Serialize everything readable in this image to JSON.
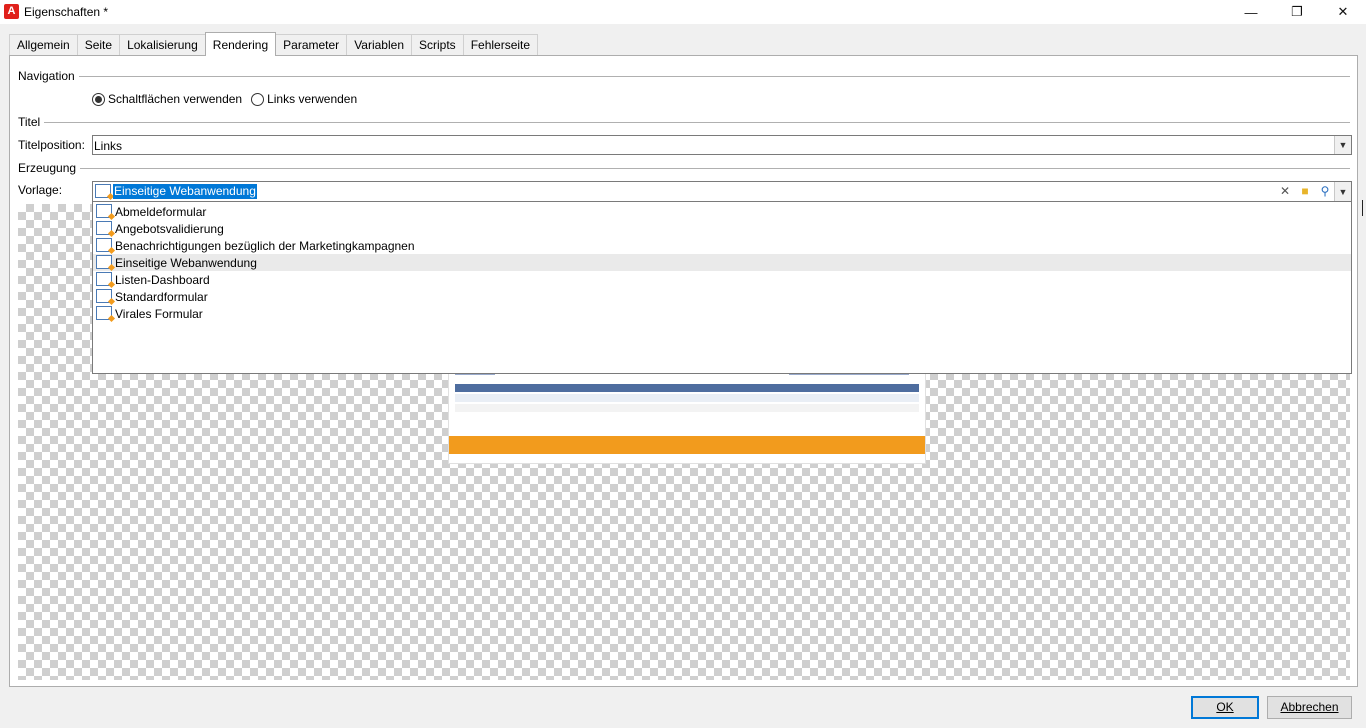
{
  "window": {
    "title": "Eigenschaften *",
    "app_icon_letter": "A",
    "controls": {
      "minimize": "—",
      "maximize": "❐",
      "close": "✕"
    }
  },
  "tabs": [
    {
      "label": "Allgemein",
      "active": false
    },
    {
      "label": "Seite",
      "active": false
    },
    {
      "label": "Lokalisierung",
      "active": false
    },
    {
      "label": "Rendering",
      "active": true
    },
    {
      "label": "Parameter",
      "active": false
    },
    {
      "label": "Variablen",
      "active": false
    },
    {
      "label": "Scripts",
      "active": false
    },
    {
      "label": "Fehlerseite",
      "active": false
    }
  ],
  "navigation": {
    "section_label": "Navigation",
    "options": [
      {
        "label": "Schaltflächen verwenden",
        "selected": true
      },
      {
        "label": "Links verwenden",
        "selected": false
      }
    ]
  },
  "titel": {
    "section_label": "Titel",
    "position_label": "Titelposition:",
    "position_value": "Links"
  },
  "erzeugung": {
    "section_label": "Erzeugung",
    "template_label": "Vorlage:",
    "template_value": "Einseitige Webanwendung",
    "dropdown_items": [
      {
        "label": "Abmeldeformular",
        "highlighted": false
      },
      {
        "label": "Angebotsvalidierung",
        "highlighted": false
      },
      {
        "label": "Benachrichtigungen bezüglich der Marketingkampagnen",
        "highlighted": false
      },
      {
        "label": "Einseitige Webanwendung",
        "highlighted": true
      },
      {
        "label": "Listen-Dashboard",
        "highlighted": false
      },
      {
        "label": "Standardformular",
        "highlighted": false
      },
      {
        "label": "Virales Formular",
        "highlighted": false
      }
    ]
  },
  "footer": {
    "ok_label": "OK",
    "cancel_label": "Abbrechen"
  },
  "colors": {
    "selection": "#0078d7",
    "accent_orange": "#f29b1d",
    "table_header": "#4e6d9f"
  }
}
